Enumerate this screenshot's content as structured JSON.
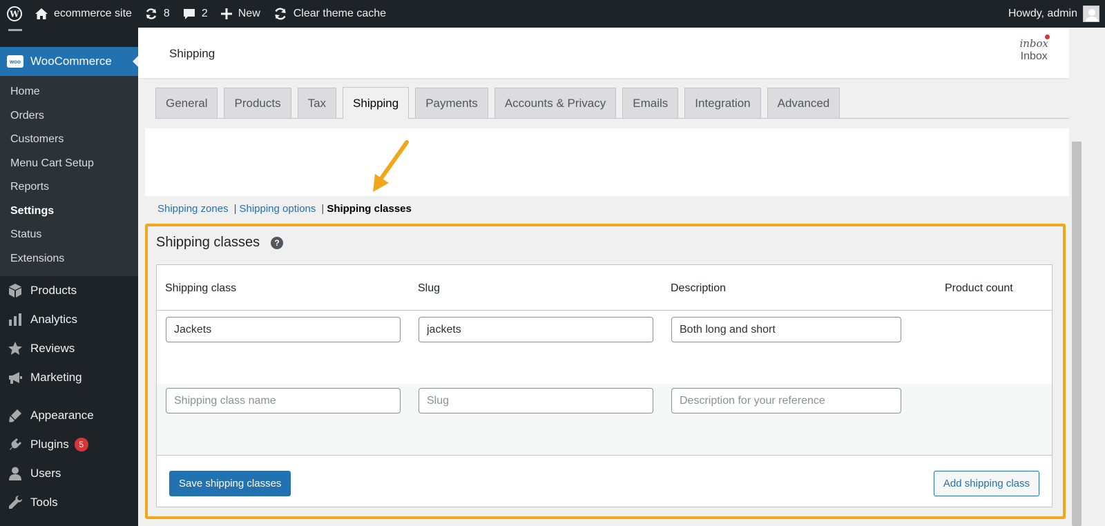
{
  "adminbar": {
    "site_name": "ecommerce site",
    "updates_count": "8",
    "comments_count": "2",
    "new_label": "New",
    "cache_label": "Clear theme cache",
    "howdy": "Howdy, admin"
  },
  "sidebar": {
    "top": {
      "label": "WooCommerce",
      "logo_text": "woo"
    },
    "submenu": [
      {
        "label": "Home"
      },
      {
        "label": "Orders"
      },
      {
        "label": "Customers"
      },
      {
        "label": "Menu Cart Setup"
      },
      {
        "label": "Reports"
      },
      {
        "label": "Settings",
        "current": true
      },
      {
        "label": "Status"
      },
      {
        "label": "Extensions"
      }
    ],
    "menu": [
      {
        "label": "Products",
        "icon": "box-icon"
      },
      {
        "label": "Analytics",
        "icon": "bar-chart-icon"
      },
      {
        "label": "Reviews",
        "icon": "star-icon"
      },
      {
        "label": "Marketing",
        "icon": "megaphone-icon"
      },
      {
        "label": "Appearance",
        "icon": "paintbrush-icon"
      },
      {
        "label": "Plugins",
        "icon": "plugin-icon",
        "badge": "5"
      },
      {
        "label": "Users",
        "icon": "user-icon"
      },
      {
        "label": "Tools",
        "icon": "wrench-icon"
      }
    ]
  },
  "header": {
    "title": "Shipping",
    "inbox_icon_text": "inbox",
    "inbox_label": "Inbox"
  },
  "tabs": [
    {
      "label": "General"
    },
    {
      "label": "Products"
    },
    {
      "label": "Tax"
    },
    {
      "label": "Shipping",
      "active": true
    },
    {
      "label": "Payments"
    },
    {
      "label": "Accounts & Privacy"
    },
    {
      "label": "Emails"
    },
    {
      "label": "Integration"
    },
    {
      "label": "Advanced"
    }
  ],
  "subsub": {
    "zones": "Shipping zones",
    "options": "Shipping options",
    "classes": "Shipping classes",
    "separator": "|"
  },
  "section": {
    "title": "Shipping classes",
    "help": "?"
  },
  "table": {
    "headers": {
      "class": "Shipping class",
      "slug": "Slug",
      "description": "Description",
      "count": "Product count"
    },
    "row1": {
      "class": "Jackets",
      "slug": "jackets",
      "description": "Both long and short"
    },
    "row2": {
      "class_placeholder": "Shipping class name",
      "slug_placeholder": "Slug",
      "description_placeholder": "Description for your reference"
    },
    "save_label": "Save shipping classes",
    "add_label": "Add shipping class"
  },
  "colors": {
    "admin_bar": "#1d2327",
    "accent": "#2271b1",
    "highlight": "#f0a719",
    "badge": "#d63638"
  }
}
